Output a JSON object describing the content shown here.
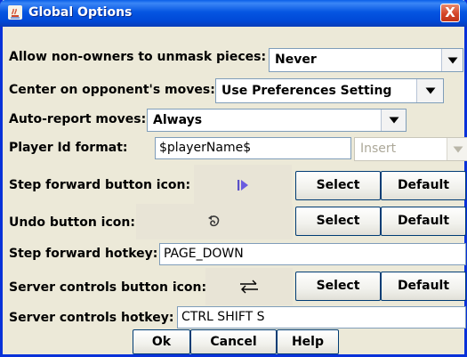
{
  "window": {
    "title": "Global Options",
    "close_label": "X",
    "colors": {
      "titlebar": "#0555E2",
      "frame": "#0831D9",
      "panel": "#ECE9D8"
    }
  },
  "options": {
    "unmask": {
      "label": "Allow non-owners to unmask pieces:",
      "value": "Never"
    },
    "center": {
      "label": "Center on opponent's moves:",
      "value": "Use Preferences Setting"
    },
    "autoreport": {
      "label": "Auto-report moves:",
      "value": "Always"
    },
    "player_id": {
      "label": "Player Id format:",
      "value": "$playerName$",
      "insert_label": "Insert"
    },
    "step_icon": {
      "label": "Step forward button icon:",
      "icon": "step-forward-icon",
      "select_label": "Select",
      "default_label": "Default"
    },
    "undo_icon": {
      "label": "Undo button icon:",
      "icon": "undo-icon",
      "select_label": "Select",
      "default_label": "Default"
    },
    "step_hotkey": {
      "label": "Step forward hotkey:",
      "value": "PAGE_DOWN"
    },
    "server_icon": {
      "label": "Server controls button icon:",
      "icon": "server-controls-icon",
      "select_label": "Select",
      "default_label": "Default"
    },
    "server_hotkey": {
      "label": "Server controls hotkey:",
      "value": "CTRL SHIFT S"
    }
  },
  "footer": {
    "ok_label": "Ok",
    "cancel_label": "Cancel",
    "help_label": "Help"
  }
}
